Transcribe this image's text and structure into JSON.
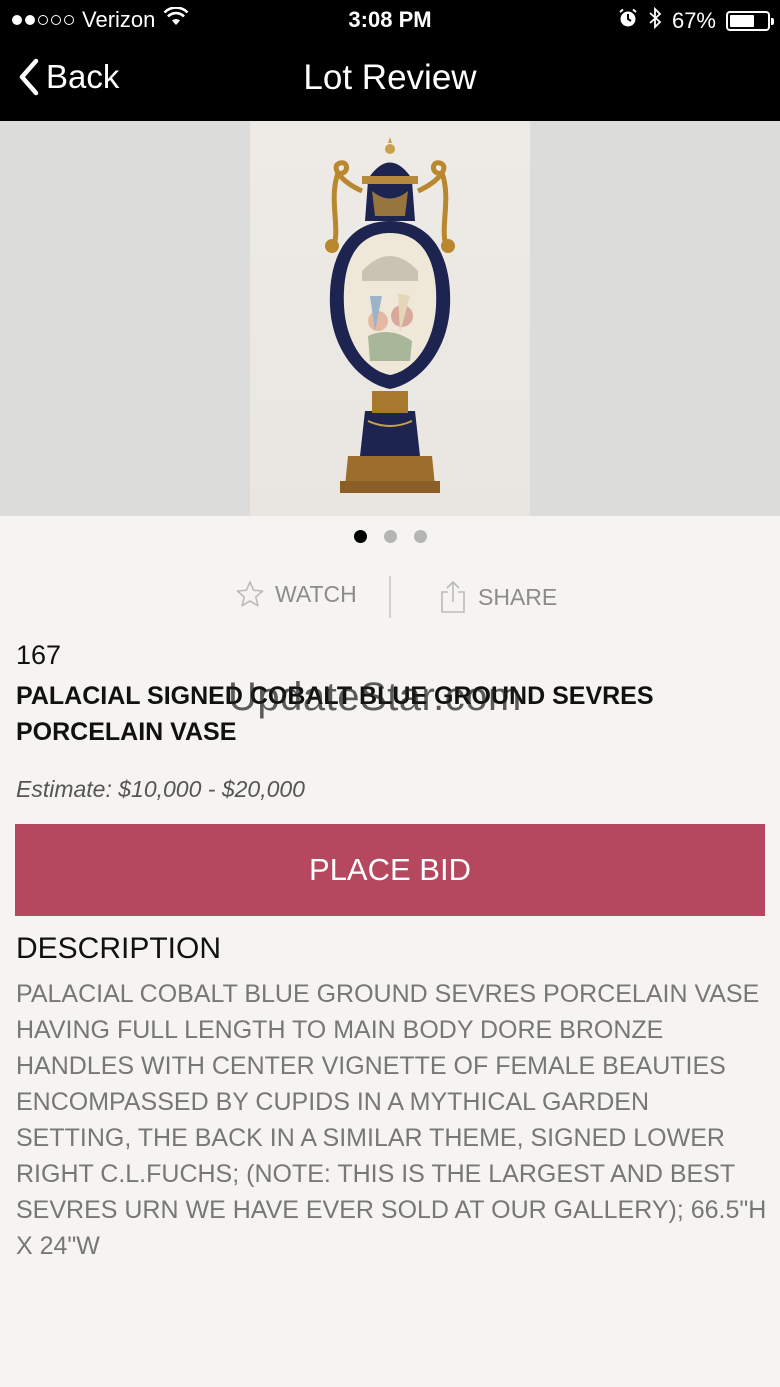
{
  "status_bar": {
    "carrier": "Verizon",
    "time": "3:08 PM",
    "battery": "67%",
    "battery_level": 0.67,
    "signal_bars": 2,
    "signal_total": 5
  },
  "nav": {
    "back_label": "Back",
    "title": "Lot Review"
  },
  "gallery": {
    "page_count": 3,
    "active_page": 1
  },
  "actions": {
    "watch_label": "WATCH",
    "share_label": "SHARE"
  },
  "lot": {
    "number": "167",
    "title": "PALACIAL SIGNED COBALT BLUE GROUND SEVRES PORCELAIN VASE",
    "estimate": "Estimate: $10,000 - $20,000",
    "place_bid_label": "PLACE BID"
  },
  "description": {
    "heading": "DESCRIPTION",
    "body": "PALACIAL COBALT BLUE GROUND SEVRES PORCELAIN VASE HAVING FULL LENGTH TO MAIN BODY DORE BRONZE HANDLES WITH CENTER VIGNETTE OF FEMALE BEAUTIES ENCOMPASSED BY CUPIDS IN A MYTHICAL GARDEN SETTING, THE BACK IN A SIMILAR THEME,  SIGNED LOWER RIGHT C.L.FUCHS;  (NOTE: THIS IS THE LARGEST AND BEST SEVRES URN WE HAVE EVER SOLD AT OUR GALLERY); 66.5\"H X 24\"W"
  },
  "watermark": "UpdateStar.com",
  "colors": {
    "accent": "#b5485f",
    "background": "#f5f4f0",
    "header": "#000000"
  }
}
